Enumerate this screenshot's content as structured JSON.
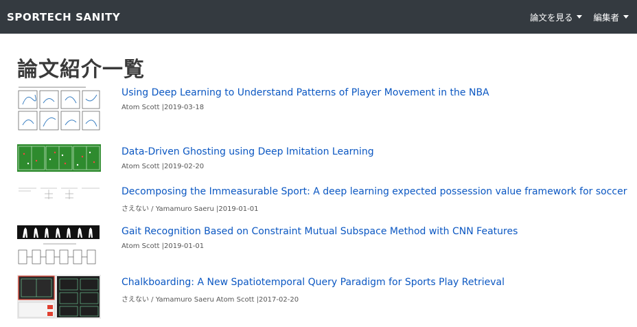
{
  "navbar": {
    "brand": "SPORTECH SANITY",
    "menu_papers": "論文を見る",
    "menu_editors": "編集者"
  },
  "page": {
    "title": "論文紹介一覧"
  },
  "papers": [
    {
      "title": "Using Deep Learning to Understand Patterns of Player Movement in the NBA",
      "meta": "Atom Scott |2019-03-18"
    },
    {
      "title": "Data-Driven Ghosting using Deep Imitation Learning",
      "meta": "Atom Scott |2019-02-20"
    },
    {
      "title": "Decomposing the Immeasurable Sport: A deep learning expected possession value framework for soccer",
      "meta": "さえない / Yamamuro Saeru |2019-01-01"
    },
    {
      "title": "Gait Recognition Based on Constraint Mutual Subspace Method with CNN Features",
      "meta": "Atom Scott |2019-01-01"
    },
    {
      "title": "Chalkboarding: A New Spatiotemporal Query Paradigm for Sports Play Retrieval",
      "meta": "さえない / Yamamuro Saeru Atom Scott |2017-02-20"
    }
  ],
  "colors": {
    "navbar": "#343a40",
    "link": "#0b57c2",
    "pitch": "#2e8b2e"
  }
}
